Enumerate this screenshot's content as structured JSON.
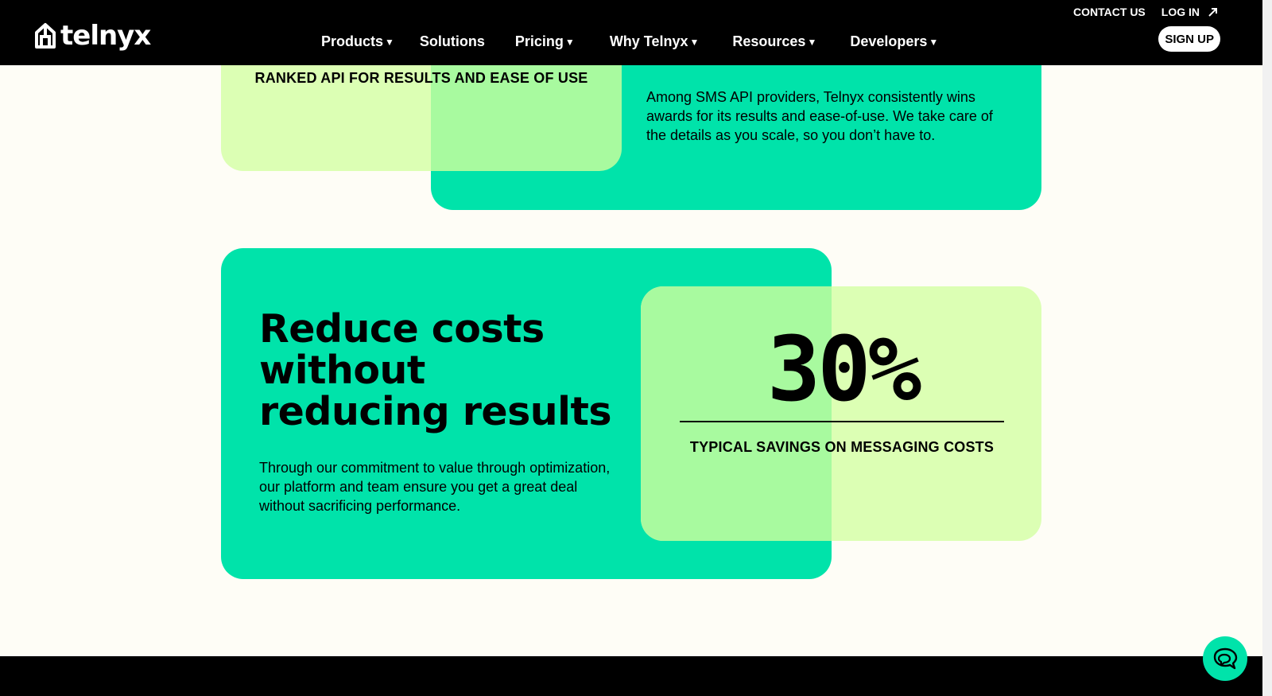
{
  "header": {
    "logo_text": "telnyx",
    "nav": [
      {
        "label": "Products",
        "has_dropdown": true
      },
      {
        "label": "Solutions",
        "has_dropdown": false
      },
      {
        "label": "Pricing",
        "has_dropdown": true
      },
      {
        "label": "Why Telnyx",
        "has_dropdown": true
      },
      {
        "label": "Resources",
        "has_dropdown": true
      },
      {
        "label": "Developers",
        "has_dropdown": true
      }
    ],
    "caret": "▼",
    "contact_label": "CONTACT US",
    "login_label": "LOG IN",
    "login_icon": "arrow-up-right-icon",
    "signup_label": "SIGN UP"
  },
  "awards": {
    "rank_label": "RANKED API FOR RESULTS AND EASE OF USE",
    "description": "Among SMS API providers, Telnyx consistently wins awards for its results and ease-of-use. We take care of the details as you scale, so you don’t have to."
  },
  "savings": {
    "title": "Reduce costs without reducing results",
    "description": "Through our commitment to value through optimization, our platform and team ensure you get a great deal without sacrificing performance.",
    "stat_value": "30%",
    "stat_label": "TYPICAL SAVINGS ON MESSAGING COSTS"
  },
  "chat_icon": "chat-bubbles-icon",
  "colors": {
    "brand_green": "#00e3aa",
    "lime": "#dcffb4",
    "overlap": "#a8fa9f",
    "background": "#fefdf6",
    "header": "#000000"
  }
}
